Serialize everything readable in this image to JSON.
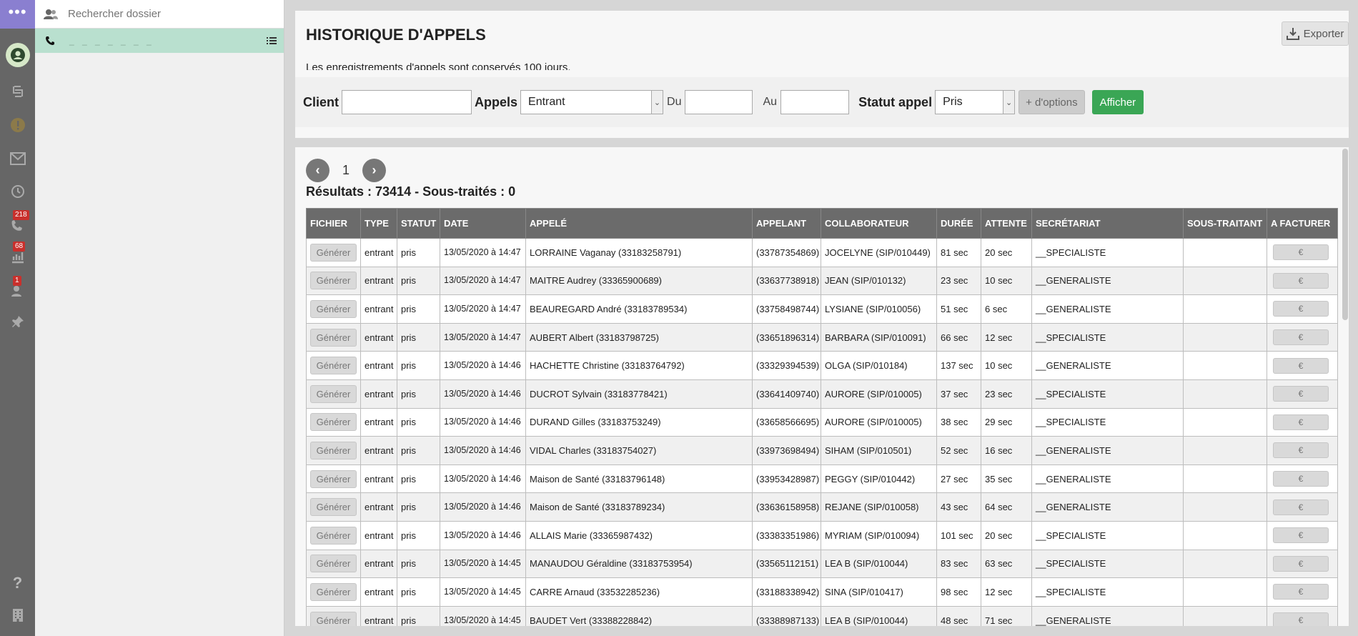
{
  "rail": {
    "badges": {
      "pending_calls": "218",
      "tasks": "68",
      "team": "1"
    }
  },
  "panel": {
    "search_placeholder": "Rechercher dossier",
    "active_entry": "_ _ _ _ _ _ _"
  },
  "header": {
    "title": "HISTORIQUE D'APPELS",
    "subtitle": "Les enregistrements d'appels sont conservés 100 jours.",
    "export_label": "Exporter"
  },
  "filters": {
    "client_label": "Client",
    "client_value": "",
    "appels_label": "Appels",
    "appels_value": "Entrant",
    "du_label": "Du",
    "du_value": "",
    "au_label": "Au",
    "au_value": "",
    "statut_label": "Statut appel",
    "statut_value": "Pris",
    "options_label": "+ d'options",
    "afficher_label": "Afficher"
  },
  "pager": {
    "prev": "‹",
    "page": "1",
    "next": "›"
  },
  "results_text": "Résultats : 73414 - Sous-traités : 0",
  "table": {
    "headers": [
      "FICHIER",
      "TYPE",
      "STATUT",
      "DATE",
      "APPELÉ",
      "APPELANT",
      "COLLABORATEUR",
      "DURÉE",
      "ATTENTE",
      "SECRÉTARIAT",
      "SOUS-TRAITANT",
      "A FACTURER"
    ],
    "generate_label": "Générer",
    "invoice_label": "€",
    "rows": [
      {
        "type": "entrant",
        "statut": "pris",
        "date": "13/05/2020 à 14:47",
        "appele": "LORRAINE Vaganay (33183258791)",
        "appelant": "(33787354869)",
        "collab": "JOCELYNE (SIP/010449)",
        "duree": "81 sec",
        "attente": "20 sec",
        "secretariat": "__SPECIALISTE",
        "sous_traitant": ""
      },
      {
        "type": "entrant",
        "statut": "pris",
        "date": "13/05/2020 à 14:47",
        "appele": "MAITRE Audrey (33365900689)",
        "appelant": "(33637738918)",
        "collab": "JEAN (SIP/010132)",
        "duree": "23 sec",
        "attente": "10 sec",
        "secretariat": "__GENERALISTE",
        "sous_traitant": ""
      },
      {
        "type": "entrant",
        "statut": "pris",
        "date": "13/05/2020 à 14:47",
        "appele": "BEAUREGARD André (33183789534)",
        "appelant": "(33758498744)",
        "collab": "LYSIANE (SIP/010056)",
        "duree": "51 sec",
        "attente": "6 sec",
        "secretariat": "__GENERALISTE",
        "sous_traitant": ""
      },
      {
        "type": "entrant",
        "statut": "pris",
        "date": "13/05/2020 à 14:47",
        "appele": "AUBERT Albert (33183798725)",
        "appelant": "(33651896314)",
        "collab": "BARBARA (SIP/010091)",
        "duree": "66 sec",
        "attente": "12 sec",
        "secretariat": "__SPECIALISTE",
        "sous_traitant": ""
      },
      {
        "type": "entrant",
        "statut": "pris",
        "date": "13/05/2020 à 14:46",
        "appele": "HACHETTE Christine (33183764792)",
        "appelant": "(33329394539)",
        "collab": "OLGA (SIP/010184)",
        "duree": "137 sec",
        "attente": "10 sec",
        "secretariat": "__GENERALISTE",
        "sous_traitant": ""
      },
      {
        "type": "entrant",
        "statut": "pris",
        "date": "13/05/2020 à 14:46",
        "appele": "DUCROT Sylvain (33183778421)",
        "appelant": "(33641409740)",
        "collab": "AURORE (SIP/010005)",
        "duree": "37 sec",
        "attente": "23 sec",
        "secretariat": "__SPECIALISTE",
        "sous_traitant": ""
      },
      {
        "type": "entrant",
        "statut": "pris",
        "date": "13/05/2020 à 14:46",
        "appele": "DURAND Gilles (33183753249)",
        "appelant": "(33658566695)",
        "collab": "AURORE (SIP/010005)",
        "duree": "38 sec",
        "attente": "29 sec",
        "secretariat": "__SPECIALISTE",
        "sous_traitant": ""
      },
      {
        "type": "entrant",
        "statut": "pris",
        "date": "13/05/2020 à 14:46",
        "appele": "VIDAL Charles (33183754027)",
        "appelant": "(33973698494)",
        "collab": "SIHAM (SIP/010501)",
        "duree": "52 sec",
        "attente": "16 sec",
        "secretariat": "__GENERALISTE",
        "sous_traitant": ""
      },
      {
        "type": "entrant",
        "statut": "pris",
        "date": "13/05/2020 à 14:46",
        "appele": "Maison de Santé (33183796148)",
        "appelant": "(33953428987)",
        "collab": "PEGGY (SIP/010442)",
        "duree": "27 sec",
        "attente": "35 sec",
        "secretariat": "__GENERALISTE",
        "sous_traitant": ""
      },
      {
        "type": "entrant",
        "statut": "pris",
        "date": "13/05/2020 à 14:46",
        "appele": "Maison de Santé (33183789234)",
        "appelant": "(33636158958)",
        "collab": "REJANE (SIP/010058)",
        "duree": "43 sec",
        "attente": "64 sec",
        "secretariat": "__GENERALISTE",
        "sous_traitant": ""
      },
      {
        "type": "entrant",
        "statut": "pris",
        "date": "13/05/2020 à 14:46",
        "appele": "ALLAIS Marie (33365987432)",
        "appelant": "(33383351986)",
        "collab": "MYRIAM (SIP/010094)",
        "duree": "101 sec",
        "attente": "20 sec",
        "secretariat": "__SPECIALISTE",
        "sous_traitant": ""
      },
      {
        "type": "entrant",
        "statut": "pris",
        "date": "13/05/2020 à 14:45",
        "appele": "MANAUDOU Géraldine (33183753954)",
        "appelant": "(33565112151)",
        "collab": "LEA B (SIP/010044)",
        "duree": "83 sec",
        "attente": "63 sec",
        "secretariat": "__SPECIALISTE",
        "sous_traitant": ""
      },
      {
        "type": "entrant",
        "statut": "pris",
        "date": "13/05/2020 à 14:45",
        "appele": "CARRE Arnaud (33532285236)",
        "appelant": "(33188338942)",
        "collab": "SINA (SIP/010417)",
        "duree": "98 sec",
        "attente": "12 sec",
        "secretariat": "__SPECIALISTE",
        "sous_traitant": ""
      },
      {
        "type": "entrant",
        "statut": "pris",
        "date": "13/05/2020 à 14:45",
        "appele": "BAUDET Vert (33388228842)",
        "appelant": "(33388987133)",
        "collab": "LEA B (SIP/010044)",
        "duree": "48 sec",
        "attente": "71 sec",
        "secretariat": "__GENERALISTE",
        "sous_traitant": ""
      }
    ]
  }
}
